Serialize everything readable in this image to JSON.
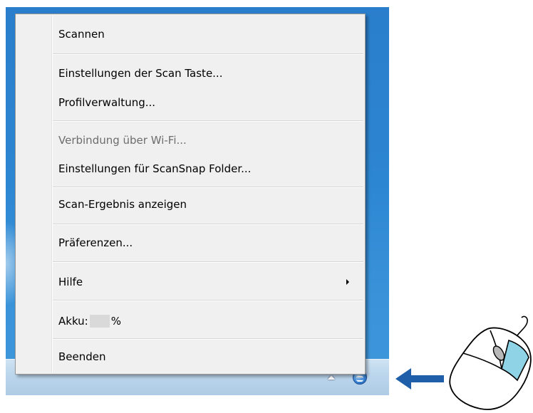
{
  "context_menu": {
    "items": [
      {
        "label": "Scannen",
        "enabled": true
      },
      {
        "label": "Einstellungen der Scan Taste...",
        "enabled": true
      },
      {
        "label": "Profilverwaltung...",
        "enabled": true
      },
      {
        "label": "Verbindung über Wi-Fi...",
        "enabled": false
      },
      {
        "label": "Einstellungen für ScanSnap Folder...",
        "enabled": true
      },
      {
        "label": "Scan-Ergebnis anzeigen",
        "enabled": true
      },
      {
        "label": "Präferenzen...",
        "enabled": true
      },
      {
        "label": "Hilfe",
        "enabled": true,
        "has_submenu": true
      },
      {
        "label": "Akku:",
        "suffix": "%",
        "enabled": true
      },
      {
        "label": "Beenden",
        "enabled": true
      }
    ]
  },
  "taskbar": {
    "tray_icons": [
      "show-hidden-icons-icon",
      "scansnap-manager-icon"
    ]
  },
  "annotation": {
    "arrow_icon": "left-arrow-icon",
    "arrow_color": "#1f5ea8",
    "mouse_icon": "mouse-right-click-icon",
    "mouse_button_color": "#8fd3e6"
  }
}
